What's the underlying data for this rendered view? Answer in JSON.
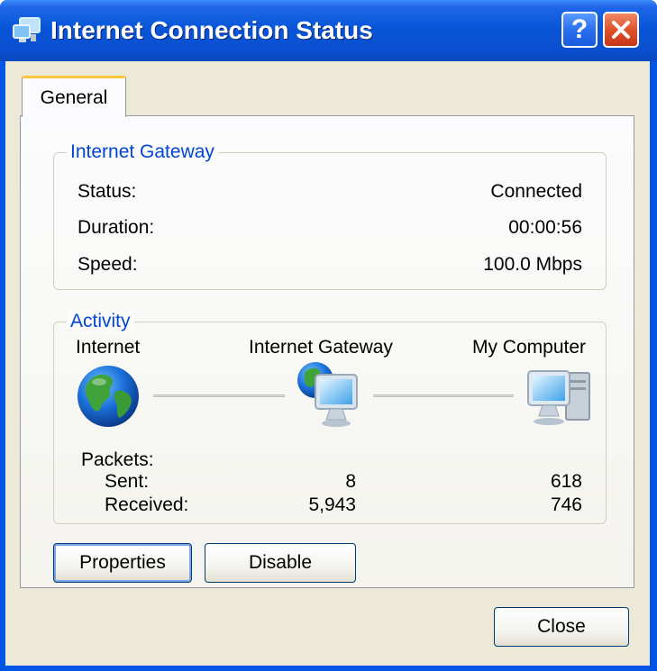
{
  "window": {
    "title": "Internet Connection Status",
    "help_label": "?",
    "close_icon": "close-icon"
  },
  "tabs": [
    {
      "label": "General",
      "selected": true
    }
  ],
  "gateway_group": {
    "legend": "Internet Gateway",
    "rows": [
      {
        "label": "Status:",
        "value": "Connected"
      },
      {
        "label": "Duration:",
        "value": "00:00:56"
      },
      {
        "label": "Speed:",
        "value": "100.0 Mbps"
      }
    ]
  },
  "activity_group": {
    "legend": "Activity",
    "nodes": [
      {
        "label": "Internet",
        "icon": "globe-icon"
      },
      {
        "label": "Internet Gateway",
        "icon": "gateway-computer-icon"
      },
      {
        "label": "My Computer",
        "icon": "my-computer-icon"
      }
    ],
    "packets_label": "Packets:",
    "sent_label": "Sent:",
    "received_label": "Received:",
    "gateway_sent": "8",
    "gateway_received": "5,943",
    "computer_sent": "618",
    "computer_received": "746"
  },
  "buttons": {
    "properties": "Properties",
    "disable": "Disable",
    "close": "Close"
  },
  "colors": {
    "titlebar": "#0856d8",
    "group_legend": "#0046d5",
    "dialog_face": "#ece9d8",
    "tab_accent": "#ffc83c"
  }
}
